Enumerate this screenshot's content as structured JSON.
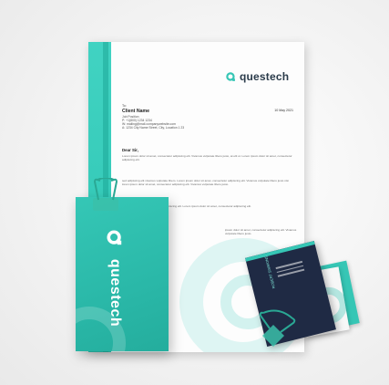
{
  "brand": {
    "name": "questech",
    "color_primary": "#36c6b5",
    "color_dark": "#1f2a44"
  },
  "letterhead": {
    "to_label": "To:",
    "client_name": "Client Name",
    "address": "Job Position\nP: +1(800) 1234 1234\nW: mailing@mail.companywebsite.com\nA: 1234 City Name Street, City, Location 1 23",
    "date": "10 May 2021",
    "salutation": "Dear Sir,",
    "paragraph1": "Lorem ipsum dolor sit amet, consectetur adipiscing elit. Vivamus vulputate libero justo, at elit ut. Lorem ipsum dolor sit amet, consectetur adipiscing elit.",
    "paragraph2": "sed adipiscing elit vivamus vulputate libero. Lorem ipsum dolor sit amet, consectetur adipiscing elit. Vivamus vulputate libero justo nisi lorem ipsum dolor sit amet, consectetur adipiscing elit. Vivamus vulputate libero justo.",
    "paragraph3": "ipsum dolor sit amet, consectetur adipiscing elit. Lorem ipsum dolor sit amet, consectetur adipiscing elit.",
    "paragraph4": "ipsum dolor sit amet, consectetur adipiscing elit. Vivamus vulputate libero justo."
  },
  "folder": {
    "logo_text": "questech"
  },
  "business_card": {
    "name": "ROBERT SIMMONS"
  }
}
